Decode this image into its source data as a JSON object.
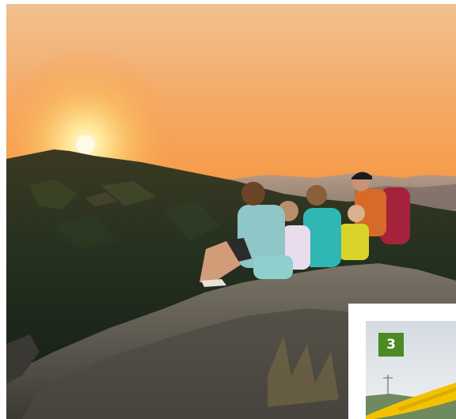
{
  "scene": {
    "sky_top": "#f0b07a",
    "sky_glow": "#f8a64a",
    "sun": "#fff4c2",
    "forest_dark": "#1d2a1a",
    "rock": "#5a5650"
  },
  "card": {
    "badge_number": "3",
    "badge_color": "#4c8a25",
    "accent": "#f2c200"
  }
}
